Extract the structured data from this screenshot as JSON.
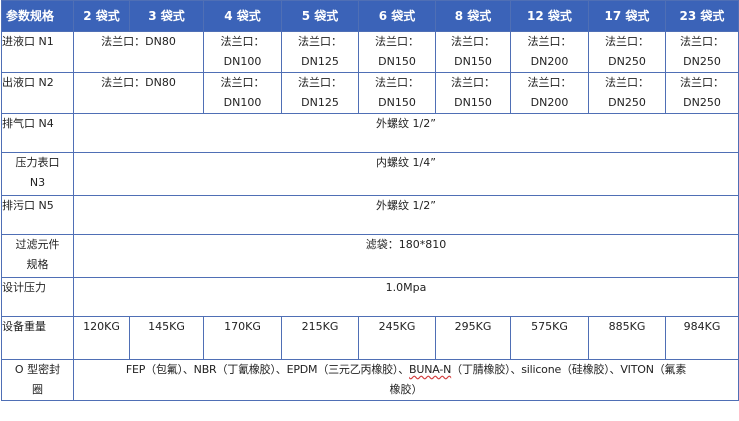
{
  "header": [
    "参数规格",
    "2 袋式",
    "3 袋式",
    "4 袋式",
    "5 袋式",
    "6 袋式",
    "8 袋式",
    "12 袋式",
    "17 袋式",
    "23 袋式"
  ],
  "inlet": {
    "label": "进液口 N1",
    "values": [
      [
        "法兰口：DN80",
        ""
      ],
      [
        "法兰口：DN80",
        ""
      ],
      [
        "法兰口：",
        "DN100"
      ],
      [
        "法兰口：",
        "DN125"
      ],
      [
        "法兰口：",
        "DN150"
      ],
      [
        "法兰口：",
        "DN150"
      ],
      [
        "法兰口：",
        "DN200"
      ],
      [
        "法兰口：",
        "DN250"
      ],
      [
        "法兰口：",
        "DN250"
      ]
    ]
  },
  "outlet": {
    "label": "出液口 N2",
    "values": [
      [
        "法兰口：DN80",
        ""
      ],
      [
        "法兰口：DN80",
        ""
      ],
      [
        "法兰口：",
        "DN100"
      ],
      [
        "法兰口：",
        "DN125"
      ],
      [
        "法兰口：",
        "DN150"
      ],
      [
        "法兰口：",
        "DN150"
      ],
      [
        "法兰口：",
        "DN200"
      ],
      [
        "法兰口：",
        "DN250"
      ],
      [
        "法兰口：",
        "DN250"
      ]
    ]
  },
  "vent": {
    "label": "排气口 N4",
    "value": "外螺纹 1/2”"
  },
  "gauge": {
    "label_1": "压力表口",
    "label_2": "N3",
    "value": "内螺纹 1/4”"
  },
  "drain": {
    "label": "排污口 N5",
    "value": "外螺纹 1/2”"
  },
  "filter": {
    "label_1": "过滤元件",
    "label_2": "规格",
    "value": "滤袋：180*810"
  },
  "pressure": {
    "label": "设计压力",
    "value": "1.0Mpa"
  },
  "weight": {
    "label": "设备重量",
    "values": [
      "120KG",
      "145KG",
      "170KG",
      "215KG",
      "245KG",
      "295KG",
      "575KG",
      "885KG",
      "984KG"
    ]
  },
  "seal": {
    "label_1": "O 型密封",
    "label_2": "圈",
    "line1_a": "FEP（包氟）、NBR（丁氰橡胶）、EPDM（三元乙丙橡胶）、",
    "line1_b": "BUNA-N",
    "line1_c": "（丁腈橡胶）、silicone（硅橡胶）、VITON（氟素",
    "line2": "橡胶）"
  },
  "colors": {
    "header_bg": "#3b63b8",
    "header_text": "#ffffff",
    "border": "#4f6fb5"
  }
}
